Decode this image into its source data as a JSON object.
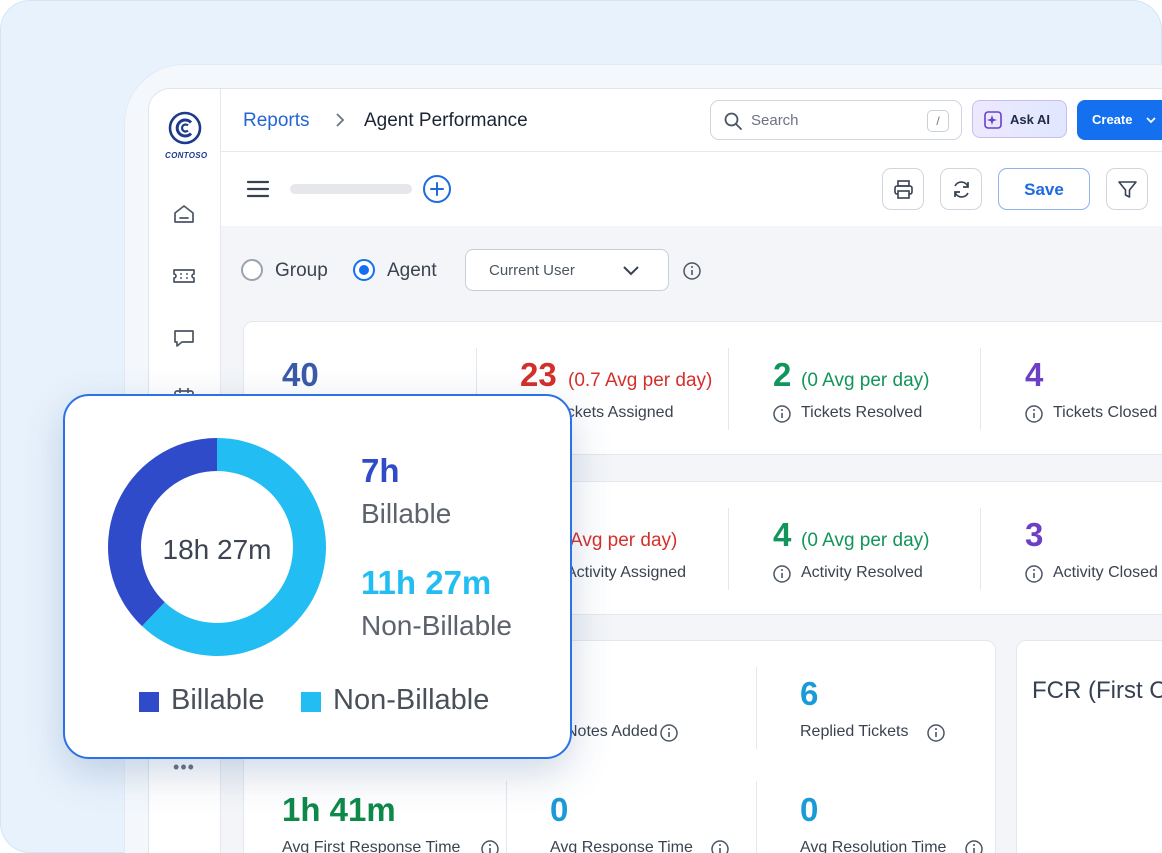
{
  "brand": {
    "name": "CONTOSO"
  },
  "breadcrumb": {
    "parent": "Reports",
    "current": "Agent Performance"
  },
  "search": {
    "placeholder": "Search",
    "shortcut": "/"
  },
  "header": {
    "ask_ai": "Ask AI",
    "create": "Create"
  },
  "toolbar": {
    "save": "Save"
  },
  "filters": {
    "options": [
      "Group",
      "Agent"
    ],
    "selected": "Agent",
    "user_select": "Current User"
  },
  "tickets": {
    "total": "40",
    "assigned": {
      "value": "23",
      "avg": "(0.7 Avg per day)",
      "label": "Tickets Assigned"
    },
    "resolved": {
      "value": "2",
      "avg": "(0 Avg per day)",
      "label": "Tickets Resolved"
    },
    "closed": {
      "value": "4",
      "label": "Tickets Closed"
    }
  },
  "activity": {
    "assigned": {
      "avg": "Avg per day)",
      "label": "Activity Assigned"
    },
    "resolved": {
      "value": "4",
      "avg": "(0 Avg per day)",
      "label": "Activity Resolved"
    },
    "closed": {
      "value": "3",
      "label": "Activity Closed"
    }
  },
  "notes": {
    "label": "Notes Added"
  },
  "replied": {
    "value": "6",
    "label": "Replied Tickets"
  },
  "response": {
    "first": {
      "value": "1h 41m",
      "label": "Avg First Response Time"
    },
    "avg": {
      "value": "0",
      "label": "Avg Response Time"
    },
    "resolution": {
      "value": "0",
      "label": "Avg Resolution Time"
    }
  },
  "fcr": {
    "title": "FCR (First C"
  },
  "time_breakdown": {
    "total": "18h 27m",
    "billable": {
      "value": "7h",
      "label": "Billable"
    },
    "non_billable": {
      "value": "11h 27m",
      "label": "Non-Billable"
    },
    "legend": [
      "Billable",
      "Non-Billable"
    ]
  },
  "chart_data": {
    "type": "pie",
    "variant": "donut",
    "categories": [
      "Billable",
      "Non-Billable"
    ],
    "values": [
      420,
      687
    ],
    "unit": "minutes",
    "colors": [
      "#2f4bc9",
      "#22bdf2"
    ],
    "legend": "bottom"
  }
}
